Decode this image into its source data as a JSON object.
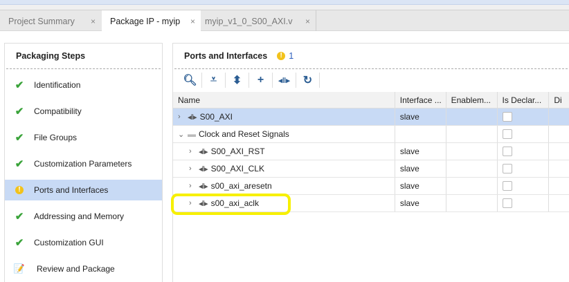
{
  "tabs": [
    {
      "label": "Project Summary",
      "close": "×"
    },
    {
      "label": "Package IP - myip",
      "close": "×"
    },
    {
      "label": "myip_v1_0_S00_AXI.v",
      "close": "×"
    }
  ],
  "left": {
    "title": "Packaging Steps",
    "steps": [
      {
        "label": "Identification",
        "status": "check"
      },
      {
        "label": "Compatibility",
        "status": "check"
      },
      {
        "label": "File Groups",
        "status": "check"
      },
      {
        "label": "Customization Parameters",
        "status": "check"
      },
      {
        "label": "Ports and Interfaces",
        "status": "warning"
      },
      {
        "label": "Addressing and Memory",
        "status": "check"
      },
      {
        "label": "Customization GUI",
        "status": "check"
      },
      {
        "label": "Review and Package",
        "status": "edit"
      }
    ]
  },
  "right": {
    "title": "Ports and Interfaces",
    "warning_count": "1",
    "toolbar": [
      "search-icon",
      "collapse-all-icon",
      "expand-all-icon",
      "add-icon",
      "interface-icon",
      "refresh-icon"
    ],
    "columns": [
      "Name",
      "Interface ...",
      "Enablem...",
      "Is Declar...",
      "Di"
    ],
    "rows": [
      {
        "name": "S00_AXI",
        "mode": "slave",
        "indent": 0,
        "type": "interface",
        "expanded": false,
        "selected": true
      },
      {
        "name": "Clock and Reset Signals",
        "mode": "",
        "indent": 0,
        "type": "folder",
        "expanded": true
      },
      {
        "name": "S00_AXI_RST",
        "mode": "slave",
        "indent": 1,
        "type": "interface",
        "expanded": false
      },
      {
        "name": "S00_AXI_CLK",
        "mode": "slave",
        "indent": 1,
        "type": "interface",
        "expanded": false
      },
      {
        "name": "s00_axi_aresetn",
        "mode": "slave",
        "indent": 1,
        "type": "interface",
        "expanded": false
      },
      {
        "name": "s00_axi_aclk",
        "mode": "slave",
        "indent": 1,
        "type": "interface",
        "expanded": false,
        "highlighted": true
      }
    ]
  },
  "colors": {
    "selection": "#c8daf5",
    "highlight": "#f7f000",
    "check": "#3aa33a",
    "warning": "#f2c21b"
  }
}
